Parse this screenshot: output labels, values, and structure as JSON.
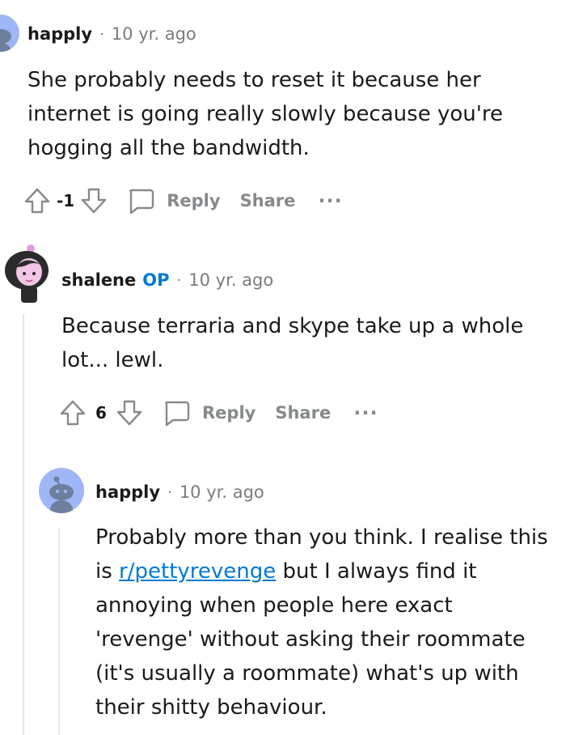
{
  "comments": [
    {
      "author": "happly",
      "op_badge": "",
      "separator": "·",
      "time": "10 yr. ago",
      "body": "She probably needs to reset it because her internet is going really slowly because you're hogging all the bandwidth.",
      "score": "-1",
      "reply_label": "Reply",
      "share_label": "Share",
      "more_label": "···"
    },
    {
      "author": "shalene",
      "op_badge": "OP",
      "separator": "·",
      "time": "10 yr. ago",
      "body": "Because terraria and skype take up a whole lot... lewl.",
      "score": "6",
      "reply_label": "Reply",
      "share_label": "Share",
      "more_label": "···"
    },
    {
      "author": "happly",
      "op_badge": "",
      "separator": "·",
      "time": "10 yr. ago",
      "body_before_link": "Probably more than you think. I realise this is ",
      "body_link": "r/pettyrevenge",
      "body_after_link": " but I always find it annoying when people here exact 'revenge' without asking their roommate (it's usually a roommate) what's up with their shitty behaviour."
    }
  ],
  "icons": {
    "upvote": "upvote-arrow-icon",
    "downvote": "downvote-arrow-icon",
    "reply": "speech-bubble-icon",
    "more": "ellipsis-icon",
    "avatar_default": "snoo-avatar-icon",
    "avatar_custom": "character-avatar-icon"
  },
  "colors": {
    "op_badge": "#0079d3",
    "link": "#0079d3",
    "action_gray": "#878a8c",
    "meta_gray": "#7c7c7c",
    "thread_line": "#e4e6e8",
    "avatar_bg": "#9fb6f7"
  }
}
